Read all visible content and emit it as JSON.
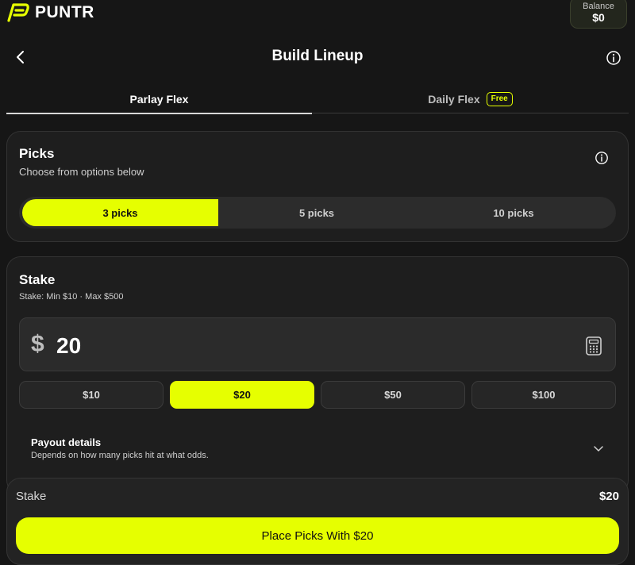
{
  "brand": {
    "name": "PUNTR",
    "accent": "#e6ff00",
    "logo_icon": "puntr-logo-icon"
  },
  "balance": {
    "label": "Balance",
    "value": "$0"
  },
  "header": {
    "title": "Build Lineup",
    "back_icon": "chevron-left-icon",
    "info_icon": "info-icon"
  },
  "tabs": [
    {
      "label": "Parlay Flex",
      "active": true
    },
    {
      "label": "Daily Flex",
      "badge": "Free",
      "active": false
    }
  ],
  "picks": {
    "title": "Picks",
    "subtitle": "Choose from options below",
    "options": [
      "3 picks",
      "5 picks",
      "10 picks"
    ],
    "selected": "3 picks"
  },
  "stake": {
    "title": "Stake",
    "subtitle": "Stake: Min $10 · Max $500",
    "currency": "$",
    "amount": "20",
    "calculator_icon": "calculator-icon",
    "presets": [
      "$10",
      "$20",
      "$50",
      "$100"
    ],
    "selected_preset": "$20"
  },
  "payout": {
    "title": "Payout details",
    "subtitle": "Depends on how many picks hit at what odds.",
    "icon": "chevron-down-icon"
  },
  "summary": {
    "stake_label": "Stake",
    "stake_value": "$20",
    "place_button_label": "Place Picks With $20"
  }
}
